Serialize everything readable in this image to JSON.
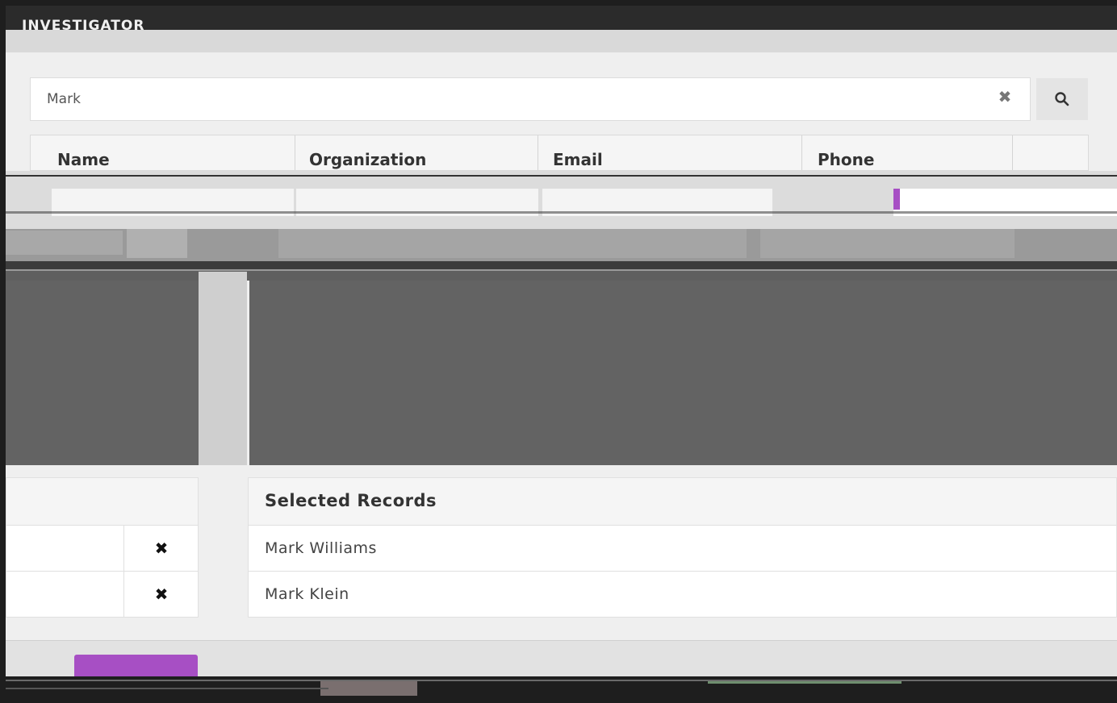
{
  "window": {
    "title": "INVESTIGATOR"
  },
  "search": {
    "value": "Mark",
    "clear_icon": "close-icon",
    "search_icon": "search-icon"
  },
  "table": {
    "columns": [
      "Name",
      "Organization",
      "Email",
      "Phone"
    ]
  },
  "selected": {
    "header": "Selected Records",
    "records": [
      "Mark Williams",
      "Mark Klein"
    ],
    "remove_icon": "close-icon"
  },
  "colors": {
    "accent": "#a74fc4",
    "dark": "#1e1e1e",
    "panel_gray": "#636363"
  }
}
